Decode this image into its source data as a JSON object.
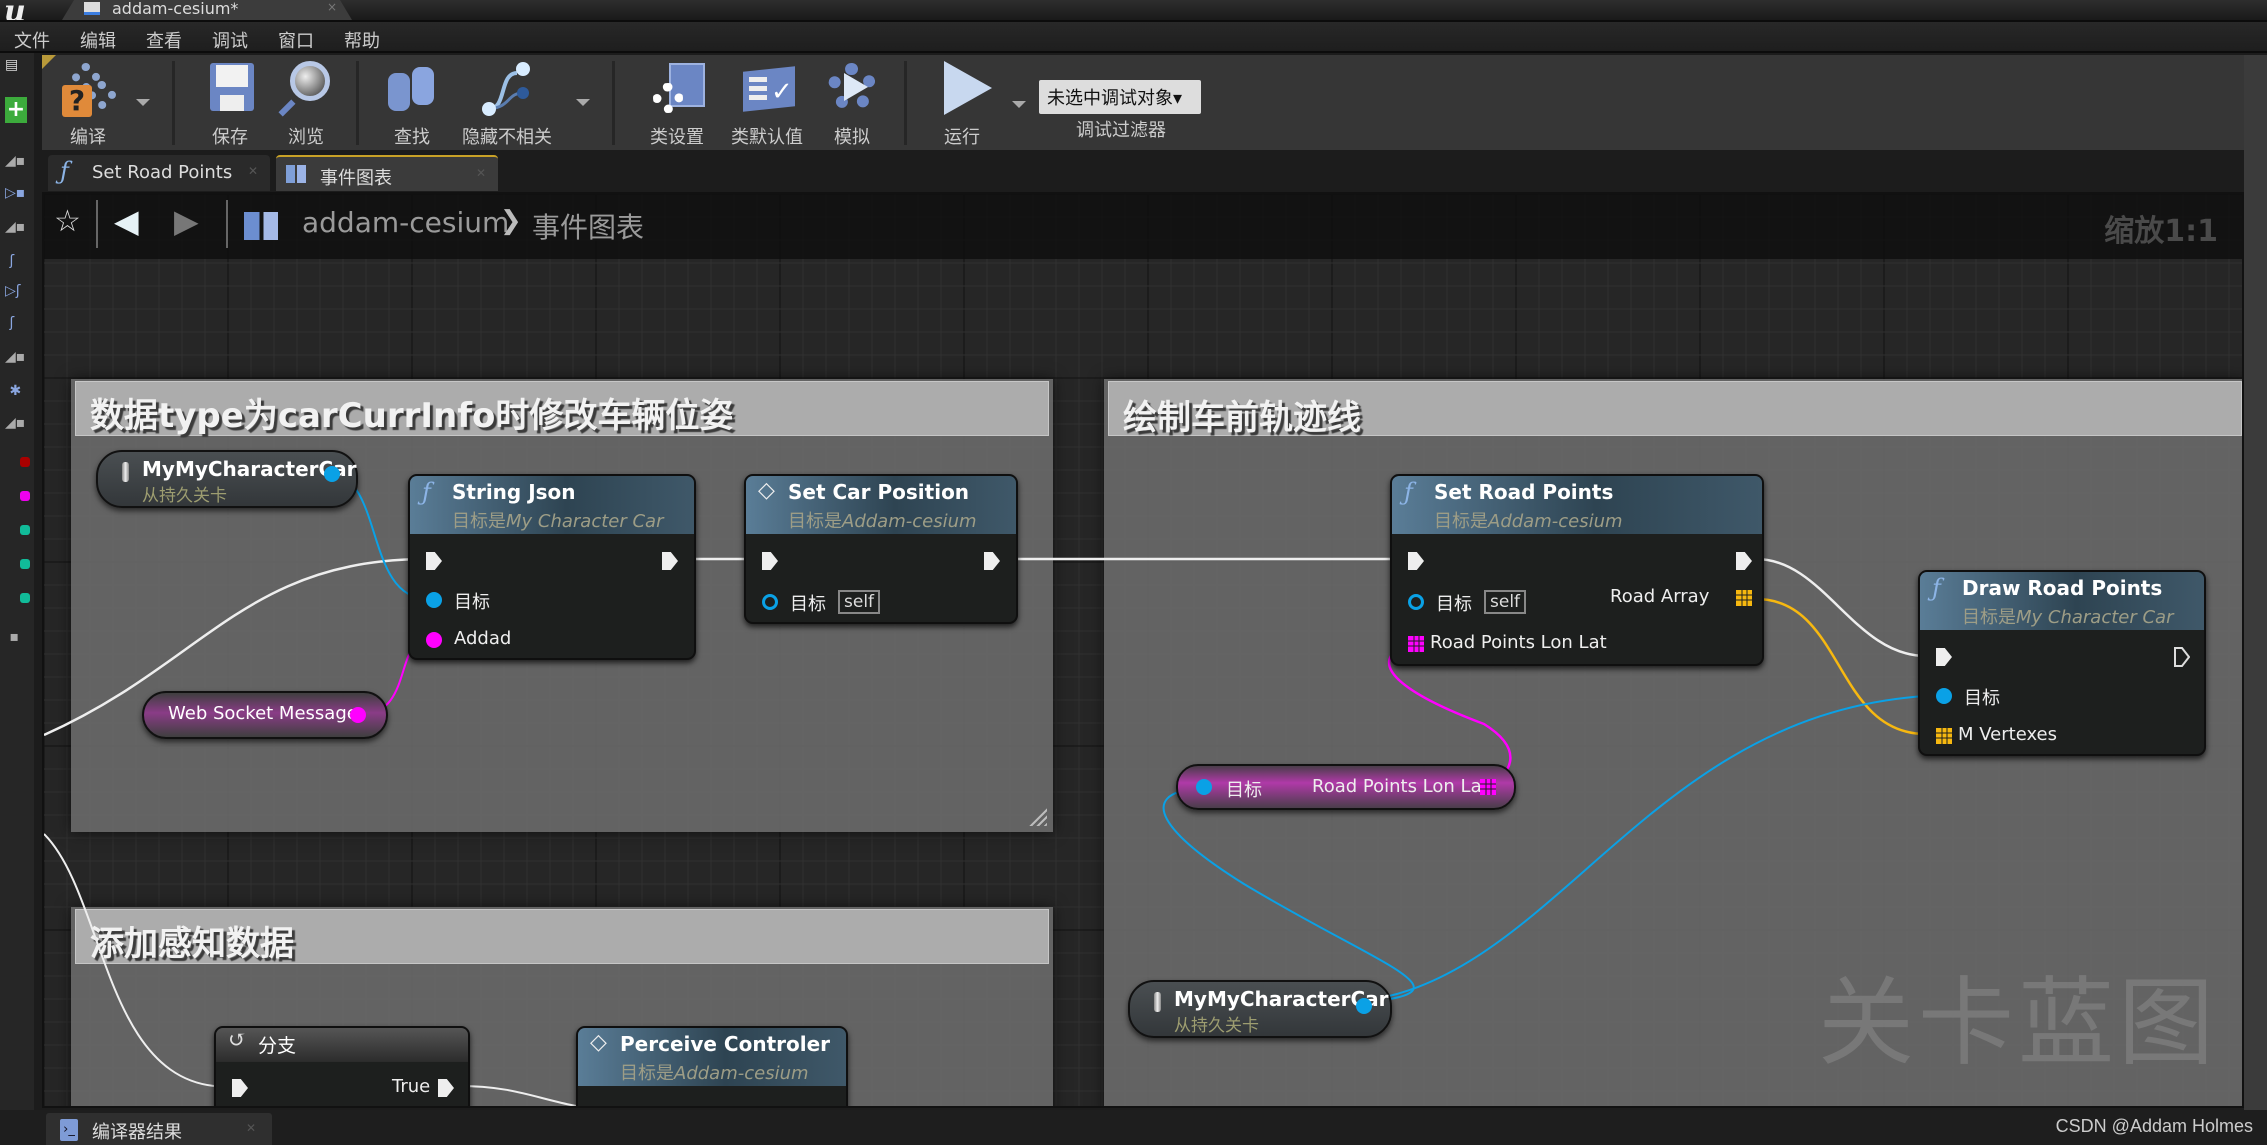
{
  "window": {
    "tab_title": "addam-cesium*",
    "close_glyph": "×"
  },
  "menu": [
    "文件",
    "编辑",
    "查看",
    "调试",
    "窗口",
    "帮助"
  ],
  "toolbar": {
    "compile": "编译",
    "save": "保存",
    "browse": "浏览",
    "find": "查找",
    "hide_unrelated": "隐藏不相关",
    "class_settings": "类设置",
    "class_defaults": "类默认值",
    "simulate": "模拟",
    "run": "运行",
    "debug_select": "未选中调试对象▾",
    "debug_filter": "调试过滤器"
  },
  "editor_tabs": [
    {
      "label": "Set Road Points",
      "icon": "function-icon",
      "active": false
    },
    {
      "label": "事件图表",
      "icon": "event-graph-icon",
      "active": true
    }
  ],
  "breadcrumb": {
    "root": "addam-cesium",
    "separator": "❯",
    "current": "事件图表"
  },
  "zoom_label": "缩放1:1",
  "watermark": "关卡蓝图",
  "colors": {
    "exec": "#ffffff",
    "object": "#0aa1e6",
    "string": "#ff00ff",
    "array": "#f7b810",
    "comment_header": "#acacac"
  },
  "comments": [
    {
      "title": "数据type为carCurrInfo时修改车辆位姿"
    },
    {
      "title": "绘制车前轨迹线"
    },
    {
      "title": "添加感知数据"
    }
  ],
  "nodes": {
    "var_car_1": {
      "title": "MyMyCharacterCar",
      "subtitle": "从持久关卡"
    },
    "web_socket": {
      "title": "Web Socket Message"
    },
    "string_json": {
      "title": "String Json",
      "sub_prefix": "目标是",
      "sub_target": "My Character Car",
      "pins": [
        "目标",
        "Addad"
      ]
    },
    "set_car_position": {
      "title": "Set Car Position",
      "sub_prefix": "目标是",
      "sub_target": "Addam-cesium",
      "pins": [
        "目标"
      ],
      "self": "self"
    },
    "set_road_points": {
      "title": "Set Road Points",
      "sub_prefix": "目标是",
      "sub_target": "Addam-cesium",
      "pins": [
        "目标",
        "Road Points Lon Lat"
      ],
      "outputs": [
        "Road Array"
      ],
      "self": "self"
    },
    "draw_road_points": {
      "title": "Draw Road Points",
      "sub_prefix": "目标是",
      "sub_target": "My Character Car",
      "pins": [
        "目标",
        "M Vertexes"
      ]
    },
    "get_road_points": {
      "input": "目标",
      "output": "Road Points Lon Lat"
    },
    "var_car_2": {
      "title": "MyMyCharacterCar",
      "subtitle": "从持久关卡"
    },
    "branch": {
      "title": "分支",
      "outputs": [
        "True"
      ]
    },
    "perceive": {
      "title": "Perceive Controler",
      "sub_prefix": "目标是",
      "sub_target": "Addam-cesium"
    }
  },
  "bottom_tab": "编译器结果",
  "credit": "CSDN @Addam Holmes"
}
